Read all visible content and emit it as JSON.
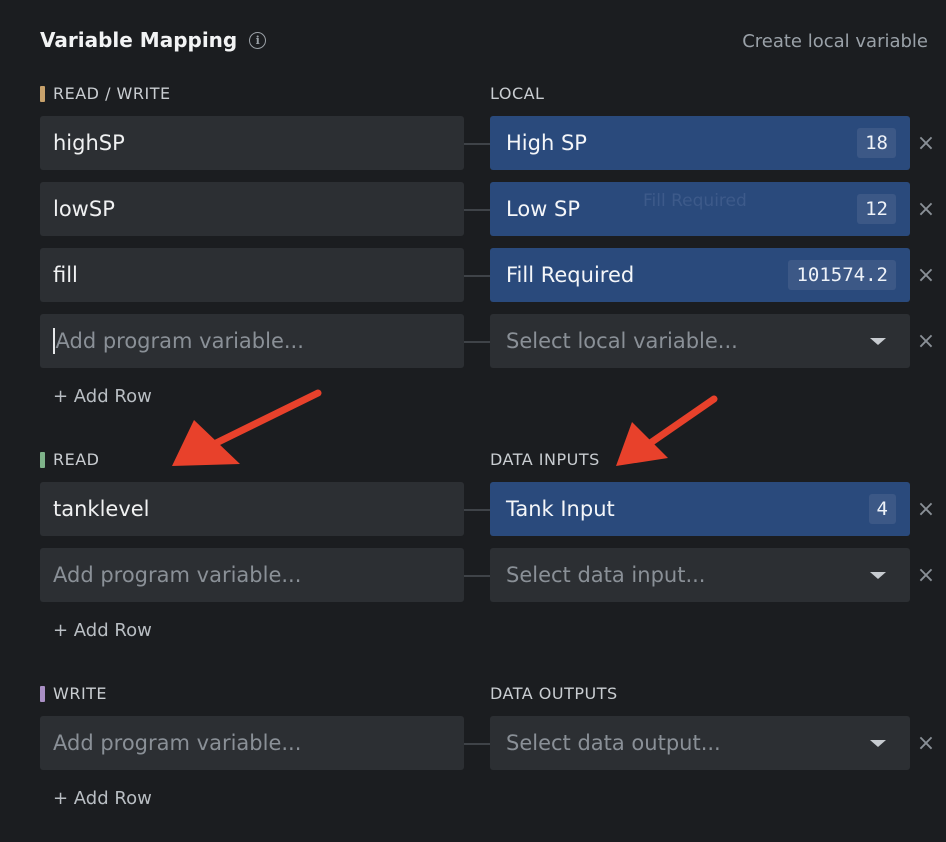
{
  "header": {
    "title": "Variable Mapping",
    "info_icon": "i",
    "create_local": "Create local variable"
  },
  "sections": {
    "read_write": {
      "label": "READ / WRITE",
      "color": "#c7a16b",
      "right_label": "LOCAL",
      "rows": [
        {
          "program": "highSP",
          "local": "High SP",
          "value": "18"
        },
        {
          "program": "lowSP",
          "local": "Low SP",
          "value": "12"
        },
        {
          "program": "fill",
          "local": "Fill Required",
          "value": "101574.2"
        }
      ],
      "add_placeholder": "Add program variable...",
      "select_placeholder": "Select local variable...",
      "add_row": "+ Add Row",
      "ghost_text": "Fill Required"
    },
    "read": {
      "label": "READ",
      "color": "#7fb38a",
      "right_label": "DATA INPUTS",
      "rows": [
        {
          "program": "tanklevel",
          "local": "Tank Input",
          "value": "4"
        }
      ],
      "add_placeholder": "Add program variable...",
      "select_placeholder": "Select data input...",
      "add_row": "+ Add Row"
    },
    "write": {
      "label": "WRITE",
      "color": "#a98fc4",
      "right_label": "DATA OUTPUTS",
      "add_placeholder": "Add program variable...",
      "select_placeholder": "Select data output...",
      "add_row": "+ Add Row"
    }
  },
  "icons": {
    "close": "×",
    "dropdown": "chevron-down-icon"
  },
  "colors": {
    "mapped": "#2a4a7c",
    "arrow": "#e8412b"
  }
}
